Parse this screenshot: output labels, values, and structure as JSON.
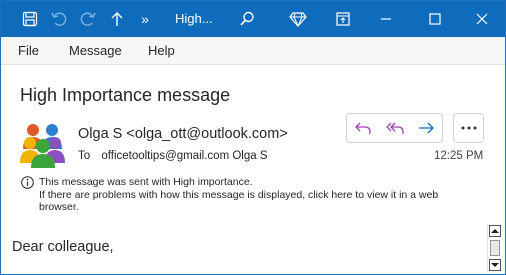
{
  "titlebar": {
    "title": "High...",
    "more_glyph": "»",
    "bg_color": "#0f6cbd",
    "icons": [
      "save-icon",
      "undo-icon",
      "redo-icon",
      "up-arrow-icon",
      "search-icon",
      "diamond-icon",
      "restore-window-icon",
      "minimize-icon",
      "maximize-icon",
      "close-icon"
    ]
  },
  "menu": {
    "items": [
      {
        "label": "File"
      },
      {
        "label": "Message"
      },
      {
        "label": "Help"
      }
    ]
  },
  "message": {
    "subject": "High Importance message",
    "sender": "Olga S <olga_ott@outlook.com>",
    "to_label": "To",
    "recipients": "officetooltips@gmail.com Olga S",
    "time": "12:25 PM",
    "info_line1": "This message was sent with High importance.",
    "info_line2": "If there are problems with how this message is displayed, click here to view it in a web browser.",
    "body_greeting": "Dear colleague,"
  },
  "actions": {
    "icons": [
      "reply-icon",
      "reply-all-icon",
      "forward-icon",
      "more-options-icon"
    ],
    "accent_color": "#a33fb4",
    "forward_color": "#0f6cbd"
  }
}
